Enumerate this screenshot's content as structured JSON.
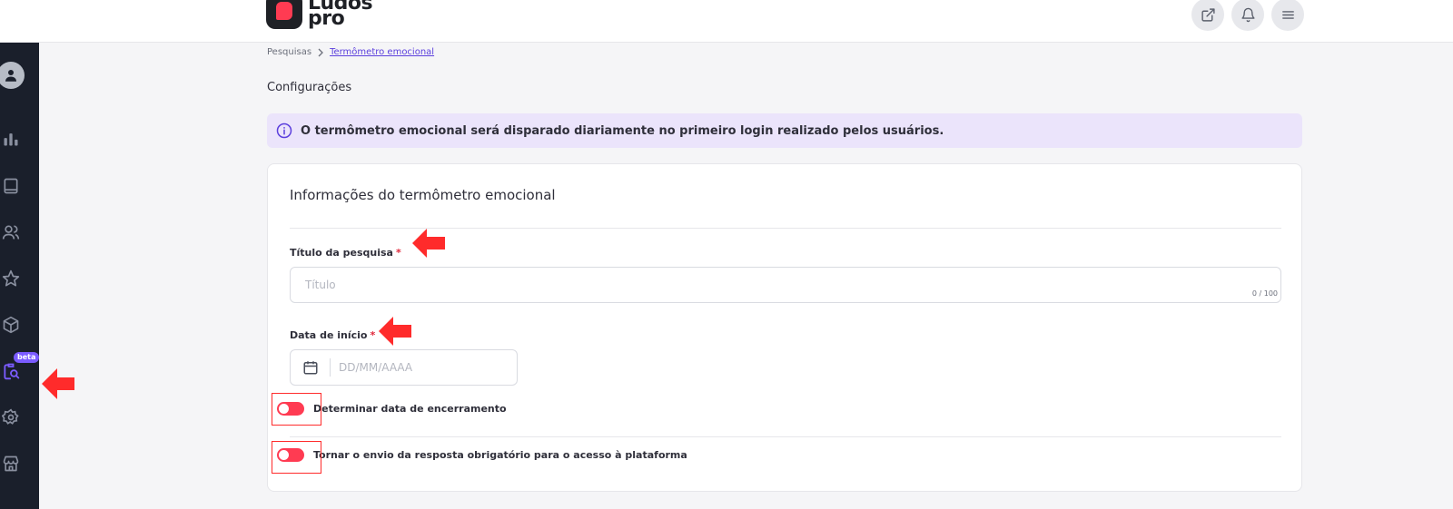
{
  "header": {
    "logo_text_line1": "Ludos",
    "logo_text_line2": "pro",
    "actions": [
      {
        "icon": "external-link-icon"
      },
      {
        "icon": "bell-icon"
      },
      {
        "icon": "menu-icon"
      }
    ]
  },
  "sidebar": {
    "items": [
      {
        "icon": "bar-chart-icon"
      },
      {
        "icon": "book-icon"
      },
      {
        "icon": "users-icon"
      },
      {
        "icon": "star-icon"
      },
      {
        "icon": "box-icon"
      },
      {
        "icon": "survey-search-icon",
        "badge": "beta",
        "active": true
      },
      {
        "icon": "gear-icon"
      },
      {
        "icon": "store-icon"
      }
    ],
    "active_color": "#7b5cff"
  },
  "breadcrumb": {
    "parent": "Pesquisas",
    "current": "Termômetro emocional"
  },
  "page": {
    "title": "Configurações"
  },
  "info_banner": {
    "text": "O termômetro emocional será disparado diariamente no primeiro login realizado pelos usuários."
  },
  "form": {
    "section_title": "Informações do termômetro emocional",
    "title_field": {
      "label": "Título da pesquisa",
      "required_mark": "*",
      "placeholder": "Título",
      "value": "",
      "counter": "0 / 100"
    },
    "date_field": {
      "label": "Data de início",
      "required_mark": "*",
      "placeholder": "DD/MM/AAAA",
      "value": ""
    },
    "toggles": [
      {
        "label": "Determinar data de encerramento",
        "state": "off"
      },
      {
        "label": "Tornar o envio da resposta obrigatório para o acesso à plataforma",
        "state": "off"
      }
    ]
  },
  "colors": {
    "accent": "#7b5cff",
    "brand_red": "#ff3b52",
    "sidebar_bg": "#1a1f2b",
    "banner_bg": "#ebe4fb",
    "annotation_red": "#ff2b2b"
  }
}
